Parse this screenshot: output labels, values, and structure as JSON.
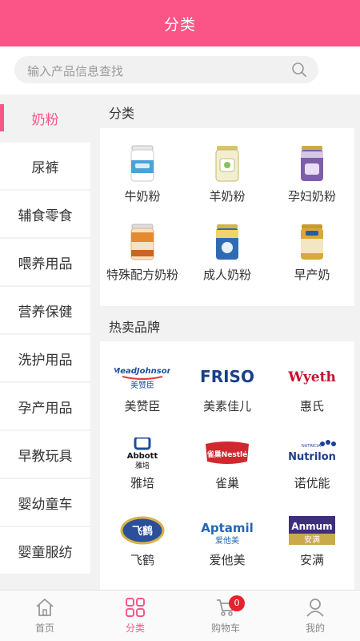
{
  "header": {
    "title": "分类"
  },
  "search": {
    "placeholder": "输入产品信息查找"
  },
  "sidebar": {
    "items": [
      {
        "label": "奶粉",
        "active": true
      },
      {
        "label": "尿裤"
      },
      {
        "label": "辅食零食"
      },
      {
        "label": "喂养用品"
      },
      {
        "label": "营养保健"
      },
      {
        "label": "洗护用品"
      },
      {
        "label": "孕产用品"
      },
      {
        "label": "早教玩具"
      },
      {
        "label": "婴幼童车"
      },
      {
        "label": "婴童服纺"
      }
    ]
  },
  "main": {
    "category_title": "分类",
    "categories": [
      {
        "label": "牛奶粉",
        "color": "#4aa3d8"
      },
      {
        "label": "羊奶粉",
        "color": "#d9c46a"
      },
      {
        "label": "孕妇奶粉",
        "color": "#7d5fa8"
      },
      {
        "label": "特殊配方奶粉",
        "color": "#e58a2e"
      },
      {
        "label": "成人奶粉",
        "color": "#2f6bb3"
      },
      {
        "label": "早产奶",
        "color": "#d8a93a"
      }
    ],
    "brand_title": "热卖品牌",
    "brands": [
      {
        "label": "美赞臣",
        "logo_text": "MeadJohnson",
        "logo_sub": "美赞臣",
        "color": "#1b4f9c"
      },
      {
        "label": "美素佳儿",
        "logo_text": "FRISO",
        "color": "#1a3f8a"
      },
      {
        "label": "惠氏",
        "logo_text": "Wyeth",
        "color": "#c8102e"
      },
      {
        "label": "雅培",
        "logo_text": "Abbott",
        "logo_sub": "雅培",
        "color": "#1c4e9a"
      },
      {
        "label": "雀巢",
        "logo_text": "雀巢Nestlé",
        "color": "#d0282e"
      },
      {
        "label": "诺优能",
        "logo_text": "Nutrilon",
        "logo_sub": "NUTRICIA",
        "color": "#1e3f91"
      },
      {
        "label": "飞鹤",
        "logo_text": "飞鹤",
        "color": "#2b4f9a"
      },
      {
        "label": "爱他美",
        "logo_text": "Aptamil",
        "logo_sub": "爱他美",
        "color": "#2467b1"
      },
      {
        "label": "安满",
        "logo_text": "Anmum",
        "logo_sub": "安满",
        "color": "#3d2f7a"
      }
    ]
  },
  "tabbar": {
    "items": [
      {
        "label": "首页",
        "icon": "home-icon"
      },
      {
        "label": "分类",
        "icon": "category-icon",
        "active": true
      },
      {
        "label": "购物车",
        "icon": "cart-icon",
        "badge": "0"
      },
      {
        "label": "我的",
        "icon": "user-icon"
      }
    ]
  }
}
